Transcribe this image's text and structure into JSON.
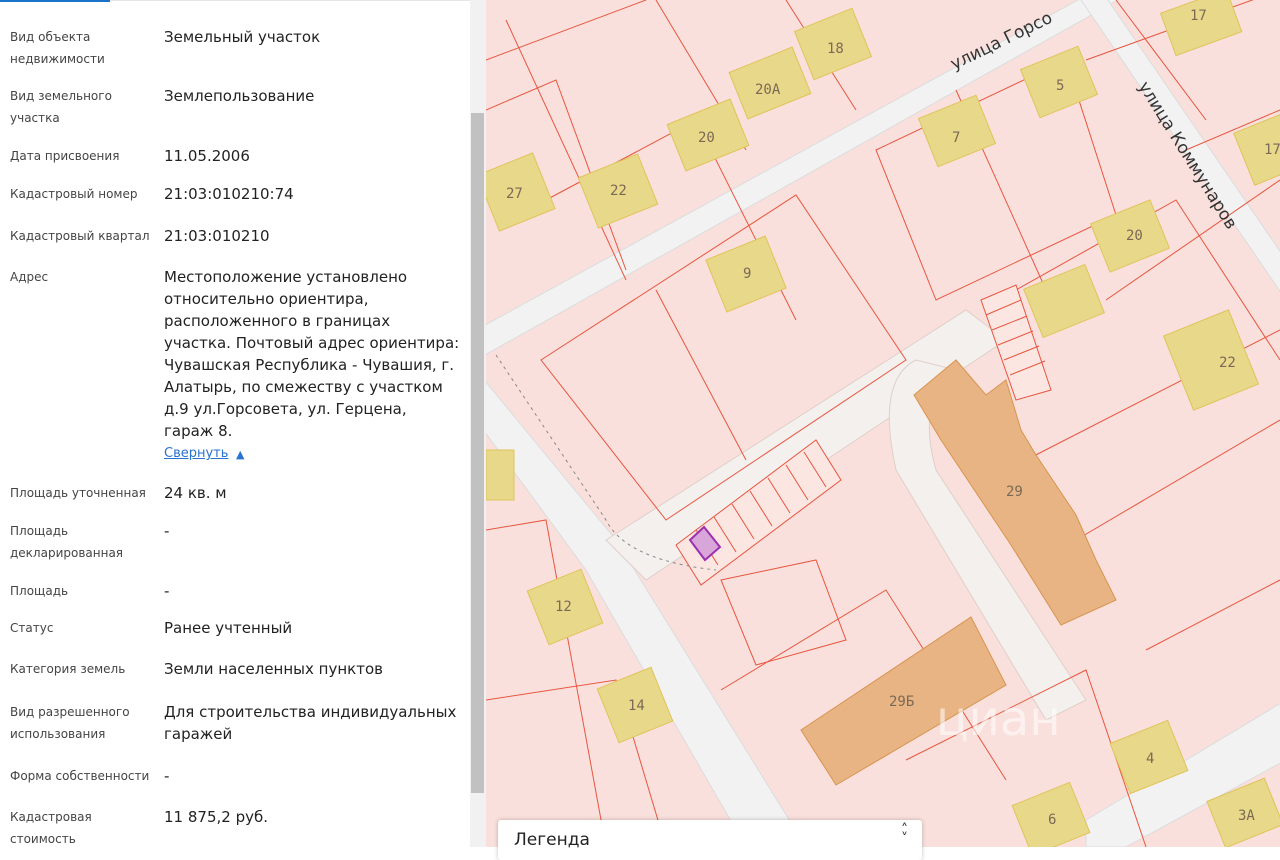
{
  "info": {
    "rows": [
      {
        "label": "Вид объекта недвижимости",
        "value": "Земельный участок"
      },
      {
        "label": "Вид земельного участка",
        "value": "Землепользование"
      },
      {
        "label": "Дата присвоения",
        "value": "11.05.2006"
      },
      {
        "label": "Кадастровый номер",
        "value": "21:03:010210:74"
      },
      {
        "label": "Кадастровый квартал",
        "value": "21:03:010210"
      },
      {
        "label": "Адрес",
        "value": "Местоположение установлено относительно ориентира, расположенного в границах участка. Почтовый адрес ориентира: Чувашская Республика - Чувашия, г. Алатырь, по смежеству с участком д.9 ул.Горсовета, ул. Герцена, гараж 8."
      },
      {
        "label": "Площадь уточненная",
        "value": "24 кв. м"
      },
      {
        "label": "Площадь декларированная",
        "value": "-"
      },
      {
        "label": "Площадь",
        "value": "-"
      },
      {
        "label": "Статус",
        "value": "Ранее учтенный"
      },
      {
        "label": "Категория земель",
        "value": "Земли населенных пунктов"
      },
      {
        "label": "Вид разрешенного использования",
        "value": "Для строительства индивидуальных гаражей"
      },
      {
        "label": "Форма собственности",
        "value": "-"
      },
      {
        "label": "Кадастровая стоимость",
        "value": "11 875,2 руб."
      }
    ],
    "collapse_label": "Свернуть",
    "collapse_icon": "chevron-up-icon"
  },
  "map": {
    "streets": [
      "улица Горсо",
      "улица Коммунаров"
    ],
    "buildings": [
      "17",
      "18",
      "20А",
      "20",
      "5",
      "7",
      "27",
      "22",
      "9",
      "20",
      "22",
      "29",
      "12",
      "14",
      "29Б",
      "4",
      "6",
      "3А",
      "17"
    ],
    "watermark": "циан",
    "colors": {
      "parcel": "#f9e0dc",
      "parcel_border": "#e8553f",
      "building": "#e8d88a",
      "building_large": "#e8b483",
      "selected": "#9b30b0"
    }
  },
  "legend": {
    "title": "Легенда",
    "toggle_icon": "chevron-up-down-icon"
  }
}
